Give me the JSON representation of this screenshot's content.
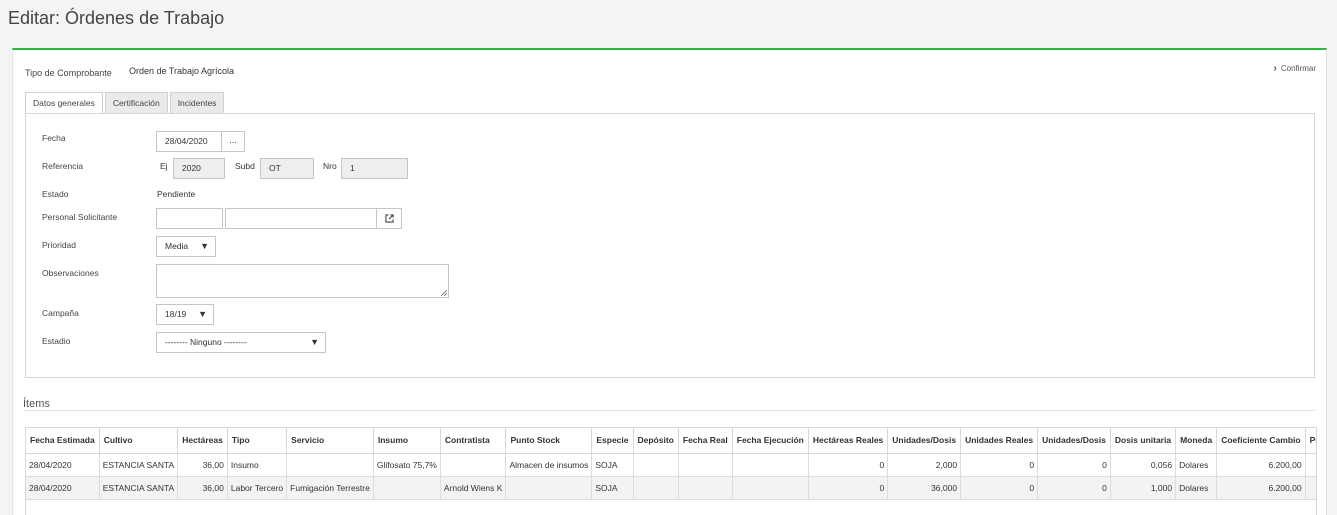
{
  "page": {
    "title": "Editar: Órdenes de Trabajo"
  },
  "header": {
    "tipo_label": "Tipo de Comprobante",
    "tipo_value": "Orden de Trabajo Agrícola",
    "confirm_label": "Confirmar",
    "confirm_icon": "chevron-right-icon"
  },
  "tabs": [
    {
      "label": "Datos generales",
      "active": true
    },
    {
      "label": "Certificación",
      "active": false
    },
    {
      "label": "Incidentes",
      "active": false
    }
  ],
  "form": {
    "fecha": {
      "label": "Fecha",
      "value": "28/04/2020",
      "picker_label": "..."
    },
    "referencia": {
      "label": "Referencia",
      "ej_label": "Ej",
      "ej_value": "2020",
      "subd_label": "Subd",
      "subd_value": "OT",
      "nro_label": "Nro",
      "nro_value": "1"
    },
    "estado": {
      "label": "Estado",
      "value": "Pendiente"
    },
    "personal": {
      "label": "Personal Solicitante",
      "code": "",
      "name": "",
      "icon": "external-link-icon"
    },
    "prioridad": {
      "label": "Prioridad",
      "value": "Media"
    },
    "observaciones": {
      "label": "Observaciones",
      "value": ""
    },
    "campana": {
      "label": "Campaña",
      "value": "18/19"
    },
    "estadio": {
      "label": "Estadio",
      "value": "-------- Ninguno --------"
    }
  },
  "items_section": {
    "title": "Ítems"
  },
  "items_table": {
    "columns": [
      "Fecha Estimada",
      "Cultivo",
      "Hectáreas",
      "Tipo",
      "Servicio",
      "Insumo",
      "Contratista",
      "Punto Stock",
      "Especie",
      "Depósito",
      "Fecha Real",
      "Fecha Ejecución",
      "Hectáreas Reales",
      "Unidades/Dosis",
      "Unidades Reales",
      "Unidades/Dosis",
      "Dosis unitaria",
      "Moneda",
      "Coeficiente Cambio",
      "Precio"
    ],
    "rows": [
      [
        "28/04/2020",
        "ESTANCIA SANTA",
        "36,00",
        "Insumo",
        "",
        "Glifosato 75,7%",
        "",
        "Almacen de insumos",
        "SOJA",
        "",
        "",
        "",
        "0",
        "2,000",
        "0",
        "0",
        "0,056",
        "Dolares",
        "6.200,00",
        ""
      ],
      [
        "28/04/2020",
        "ESTANCIA SANTA",
        "36,00",
        "Labor Tercero",
        "Fumigación Terrestre",
        "",
        "Arnold Wiens K",
        "",
        "SOJA",
        "",
        "",
        "",
        "0",
        "36,000",
        "0",
        "0",
        "1,000",
        "Dolares",
        "6.200,00",
        ""
      ]
    ]
  }
}
